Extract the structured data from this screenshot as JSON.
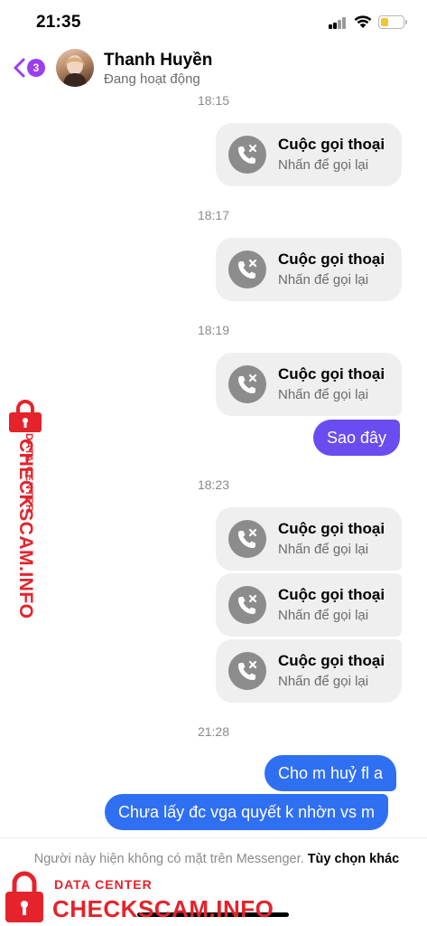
{
  "status_bar": {
    "time": "21:35"
  },
  "header": {
    "back_badge": "3",
    "contact_name": "Thanh Huyền",
    "contact_status": "Đang hoạt động"
  },
  "messages": {
    "time_1": "18:15",
    "time_2": "18:17",
    "time_3": "18:19",
    "time_4": "18:23",
    "time_5": "21:28",
    "call_title": "Cuộc gọi thoại",
    "call_sub": "Nhấn để gọi lại",
    "bubble_1": "Sao đây",
    "bubble_2": "Cho m huỷ fl a",
    "bubble_3": "Chưa lấy đc vga quyết k nhờn vs m"
  },
  "footer": {
    "notice": "Người này hiện không có mặt trên Messenger.",
    "link": "Tùy chọn khác"
  },
  "watermark": {
    "small": "DATA CENTER",
    "big": "CHECKSCAM.INFO"
  },
  "colors": {
    "accent_purple": "#6a4cf0",
    "accent_blue": "#2f6ff2",
    "badge": "#9b3ef0",
    "watermark": "#e4232b"
  }
}
